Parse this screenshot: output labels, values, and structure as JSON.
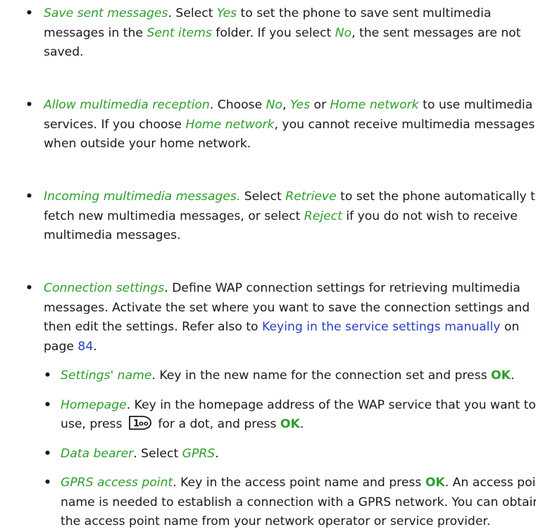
{
  "items": [
    {
      "term": "Save sent messages",
      "t1": ". Select ",
      "opt1": "Yes",
      "t2": " to set the phone to save sent multimedia messages in the ",
      "opt2": "Sent items",
      "t3": " folder. If you select ",
      "opt3": "No",
      "t4": ", the sent messages are not saved."
    },
    {
      "term": "Allow multimedia reception",
      "t1": ". Choose ",
      "opt1": "No",
      "t2": ", ",
      "opt2": "Yes",
      "t3": " or ",
      "opt3": "Home network",
      "t4": " to use multimedia services. If you choose ",
      "opt4": "Home network",
      "t5": ", you cannot receive multimedia messages when outside your home network."
    },
    {
      "term": "Incoming multimedia messages.",
      "t1": " Select ",
      "opt1": "Retrieve",
      "t2": " to set the phone automatically to fetch new multimedia messages, or select ",
      "opt2": "Reject",
      "t3": " if you do not wish to receive multimedia messages."
    },
    {
      "term": "Connection settings",
      "t1": ". Define WAP connection settings for retrieving multimedia messages. Activate the set where you want to save the connection settings and then edit the settings. Refer also to ",
      "link": "Keying in the service settings manually",
      "t2": " on page ",
      "page": "84",
      "t3": ".",
      "sub": [
        {
          "term": "Settings' name",
          "t1": ". Key in the new name for the connection set and press ",
          "ok": "OK",
          "t2": "."
        },
        {
          "term": "Homepage",
          "t1": ". Key in the homepage address of the WAP service that you want to use, press ",
          "t2": " for a dot, and press ",
          "ok": "OK",
          "t3": "."
        },
        {
          "term": "Data bearer",
          "t1": ". Select ",
          "opt1": "GPRS",
          "t2": "."
        },
        {
          "term": "GPRS access point",
          "t1": ". Key in the access point name and press ",
          "ok": "OK",
          "t2": ". An access point name is needed to establish a connection with a GPRS network. You can obtain the access point name from your network operator or service provider."
        }
      ]
    }
  ],
  "bullet": "•",
  "key_icon": "key-1-icon"
}
